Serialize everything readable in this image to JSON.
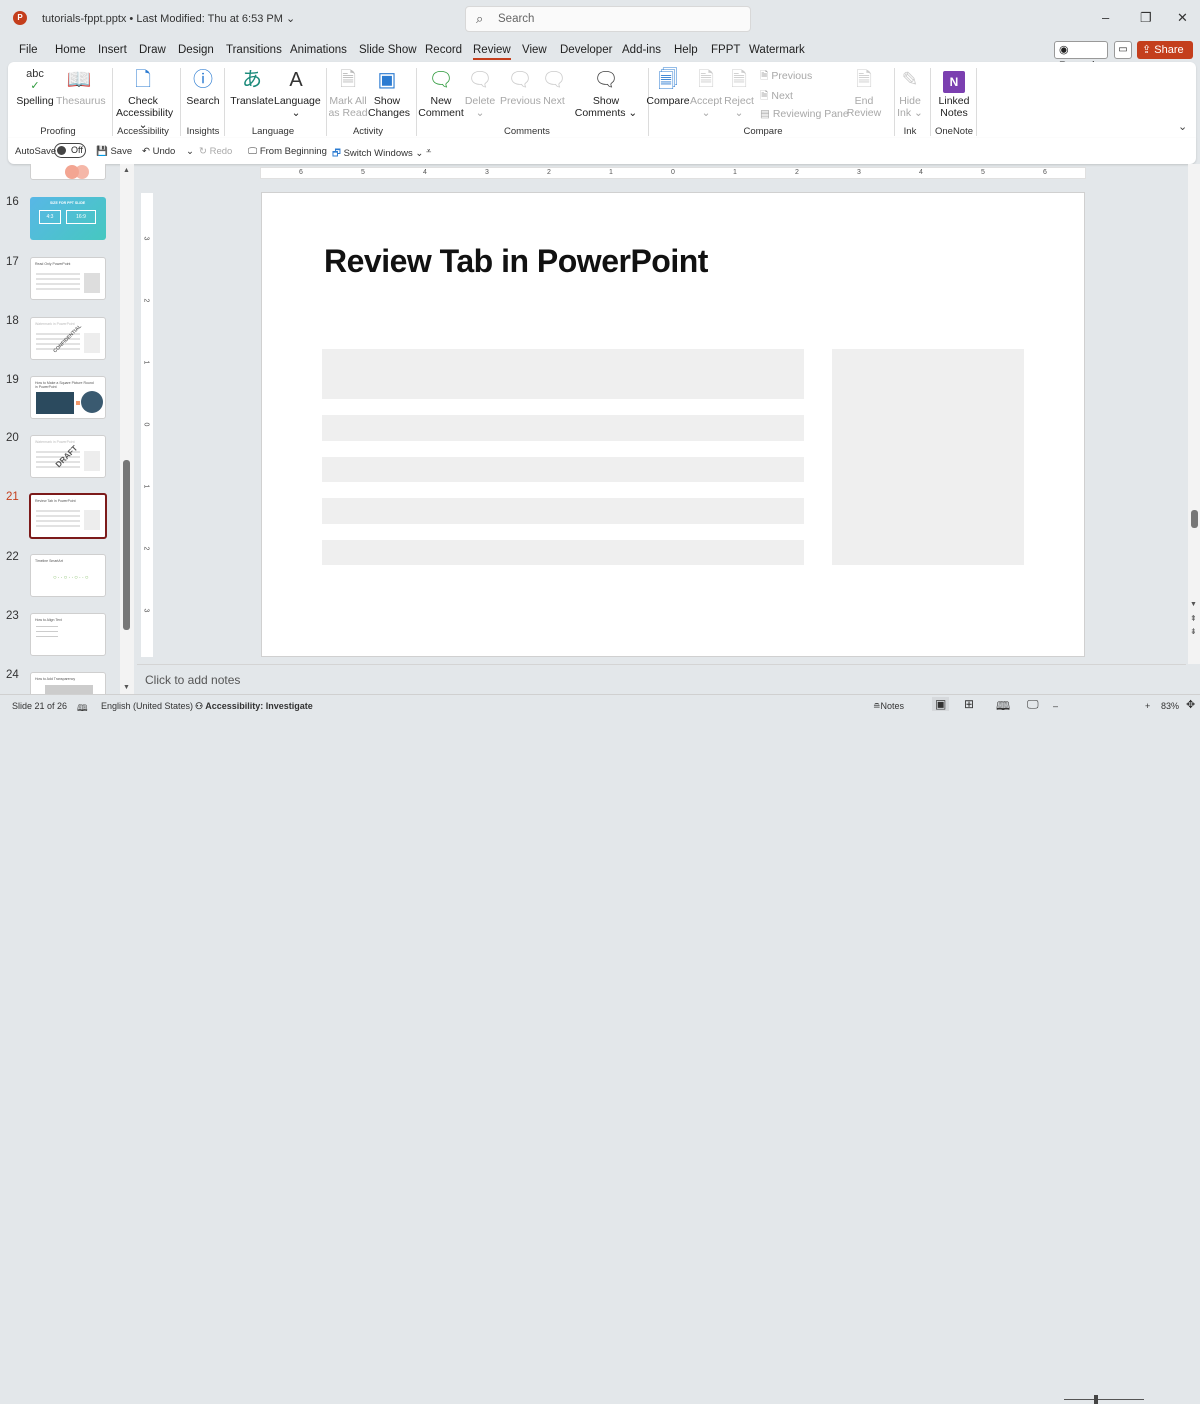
{
  "titlebar": {
    "app_icon": "P",
    "doc_title": "tutorials-fppt.pptx • Last Modified: Thu at 6:53 PM ⌄",
    "search_placeholder": "Search",
    "minimize": "–",
    "restore": "❐",
    "close": "✕"
  },
  "tabs": [
    "File",
    "Home",
    "Insert",
    "Draw",
    "Design",
    "Transitions",
    "Animations",
    "Slide Show",
    "Record",
    "Review",
    "View",
    "Developer",
    "Add-ins",
    "Help",
    "FPPT",
    "Watermark"
  ],
  "active_tab": "Review",
  "header_buttons": {
    "record": "◉ Record",
    "comments": "▭",
    "share": "⇪ Share ⌄"
  },
  "ribbon": {
    "proofing": {
      "label": "Proofing",
      "spelling": "Spelling",
      "thesaurus": "Thesaurus"
    },
    "accessibility": {
      "label": "Accessibility",
      "check": "Check",
      "check2": "Accessibility ⌄"
    },
    "insights": {
      "label": "Insights",
      "search": "Search"
    },
    "language": {
      "label": "Language",
      "translate": "Translate",
      "language": "Language",
      "language2": "⌄"
    },
    "activity": {
      "label": "Activity",
      "mark1": "Mark All",
      "mark2": "as Read",
      "show1": "Show",
      "show2": "Changes"
    },
    "comments": {
      "label": "Comments",
      "new1": "New",
      "new2": "Comment",
      "delete": "Delete",
      "delete2": "⌄",
      "previous": "Previous",
      "next": "Next",
      "show1": "Show",
      "show2": "Comments ⌄"
    },
    "compare": {
      "label": "Compare",
      "compare": "Compare",
      "accept": "Accept",
      "accept2": "⌄",
      "reject": "Reject",
      "reject2": "⌄",
      "previous": "Previous",
      "next": "Next",
      "reviewing_pane": "Reviewing Pane",
      "end1": "End",
      "end2": "Review"
    },
    "ink": {
      "label": "Ink",
      "hide1": "Hide",
      "hide2": "Ink ⌄"
    },
    "onenote": {
      "label": "OneNote",
      "linked1": "Linked",
      "linked2": "Notes"
    },
    "collapse": "⌄"
  },
  "qat": {
    "autosave": "AutoSave",
    "autosave_state": "Off",
    "save": "Save",
    "undo": "Undo",
    "undo_drop": "⌄",
    "redo": "Redo",
    "from_beginning": "From Beginning",
    "switch_windows": "Switch Windows ⌄",
    "customize": "⩡"
  },
  "thumbnails": [
    {
      "num": "16",
      "title": "SIZE FOR PPT SLIDE",
      "a": "4:3",
      "b": "16:9"
    },
    {
      "num": "17",
      "title": "Read Only PowerPoint"
    },
    {
      "num": "18",
      "title": "Watermark in PowerPoint",
      "stamp": "CONFIDENTIAL"
    },
    {
      "num": "19",
      "title": "How to Make a Square Picture Round in PowerPoint"
    },
    {
      "num": "20",
      "title": "Watermark in PowerPoint",
      "stamp": "DRAFT"
    },
    {
      "num": "21",
      "title": "Review Tab in PowerPoint"
    },
    {
      "num": "22",
      "title": "Timeline SmartArt"
    },
    {
      "num": "23",
      "title": "How to Align Text"
    },
    {
      "num": "24",
      "title": "How to Add Transparency"
    }
  ],
  "current_slide": "21",
  "hruler": [
    "6",
    "5",
    "4",
    "3",
    "2",
    "1",
    "0",
    "1",
    "2",
    "3",
    "4",
    "5",
    "6"
  ],
  "vruler": [
    "3",
    "2",
    "1",
    "0",
    "1",
    "2",
    "3"
  ],
  "slide": {
    "title": "Review Tab in PowerPoint"
  },
  "notes_placeholder": "Click to add notes",
  "status": {
    "slide": "Slide 21 of 26",
    "language": "English (United States)",
    "accessibility": "Accessibility: Investigate",
    "notes": "Notes",
    "zoom": "83%",
    "zoom_minus": "–",
    "zoom_plus": "+"
  }
}
